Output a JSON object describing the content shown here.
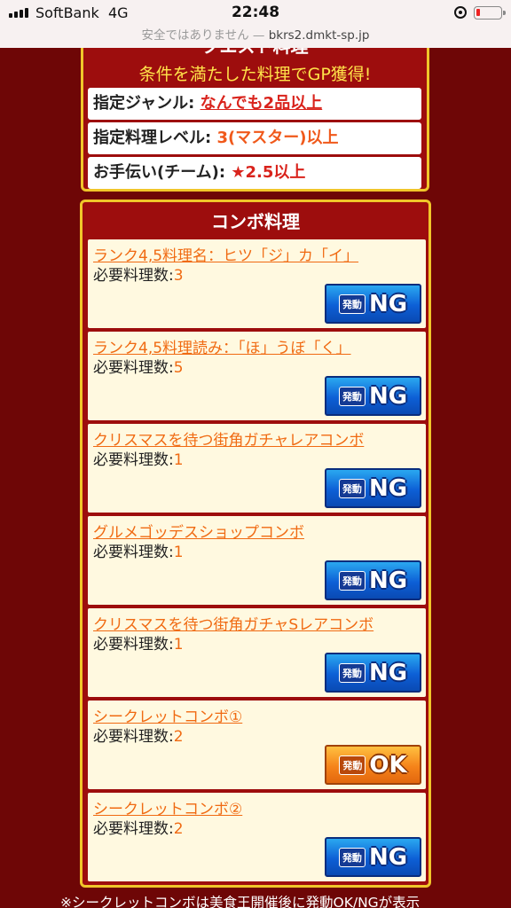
{
  "status_bar": {
    "carrier": "SoftBank",
    "network": "4G",
    "time": "22:48",
    "insecure_label": "安全ではありません —",
    "host": "bkrs2.dmkt-sp.jp"
  },
  "quest": {
    "title": "クエスト料理",
    "subtitle": "条件を満たした料理でGP獲得!",
    "conditions": [
      {
        "label": "指定ジャンル: ",
        "value": "なんでも2品以上"
      },
      {
        "label": "指定料理レベル: ",
        "value": "3(マスター)以上"
      },
      {
        "label": "お手伝い(チーム): ",
        "value": "★2.5以上"
      }
    ]
  },
  "combo": {
    "title": "コンボ料理",
    "req_label": "必要料理数:",
    "items": [
      {
        "name": "ランク4,5料理名：ヒツ「ジ」カ「イ」",
        "count": "3",
        "status": "NG"
      },
      {
        "name": "ランク4,5料理読み：「ほ」うぼ「く」",
        "count": "5",
        "status": "NG"
      },
      {
        "name": "クリスマスを待つ街角ガチャレアコンボ",
        "count": "1",
        "status": "NG"
      },
      {
        "name": "グルメゴッデスショップコンボ",
        "count": "1",
        "status": "NG"
      },
      {
        "name": "クリスマスを待つ街角ガチャSレアコンボ",
        "count": "1",
        "status": "NG"
      },
      {
        "name": "シークレットコンボ①",
        "count": "2",
        "status": "OK"
      },
      {
        "name": "シークレットコンボ②",
        "count": "2",
        "status": "NG"
      }
    ],
    "button_prefix": "発動"
  },
  "footnote": "※シークレットコンボは美食王開催後に発動OK/NGが表示",
  "colors": {
    "background": "#6e0606",
    "panel": "#9d0d0d",
    "border": "#f0c62a",
    "ng_button": "#0d5fd6",
    "ok_button": "#f5831a"
  }
}
